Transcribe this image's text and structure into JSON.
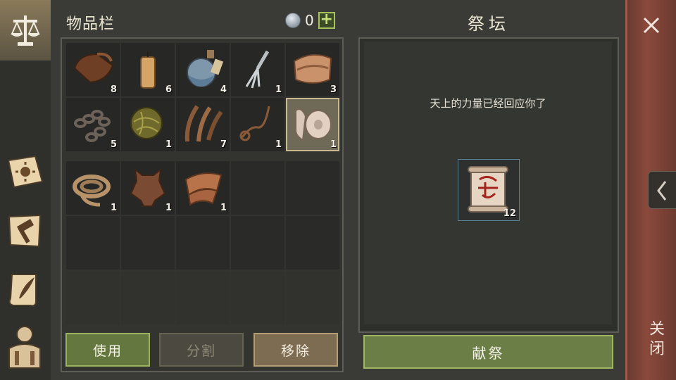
{
  "rail": {
    "icons": [
      "scales-icon",
      "sun-book-icon",
      "hammer-map-icon",
      "quill-scroll-icon",
      "character-icon"
    ]
  },
  "inventory": {
    "title": "物品栏",
    "currency_value": "0",
    "add_label": "+",
    "top_slots": [
      {
        "icon": "leather-scroll-icon",
        "qty": "8"
      },
      {
        "icon": "candle-icon",
        "qty": "6"
      },
      {
        "icon": "potion-flask-icon",
        "qty": "4"
      },
      {
        "icon": "fork-trap-icon",
        "qty": "1"
      },
      {
        "icon": "cloth-bundle-icon",
        "qty": "3"
      },
      {
        "icon": "chain-icon",
        "qty": "5"
      },
      {
        "icon": "vine-ball-icon",
        "qty": "1"
      },
      {
        "icon": "fiber-strands-icon",
        "qty": "7"
      },
      {
        "icon": "whip-icon",
        "qty": "1"
      },
      {
        "icon": "cloth-roll-icon",
        "qty": "1"
      }
    ],
    "bottom_slots": [
      {
        "icon": "rope-coil-icon",
        "qty": "1"
      },
      {
        "icon": "animal-hide-icon",
        "qty": "1"
      },
      {
        "icon": "fabric-piece-icon",
        "qty": "1"
      }
    ],
    "buttons": {
      "use": "使用",
      "split": "分割",
      "remove": "移除"
    }
  },
  "altar": {
    "title": "祭坛",
    "message": "天上的力量已经回应你了",
    "slot": {
      "icon": "rune-scroll-icon",
      "qty": "12"
    },
    "offer": "献祭"
  },
  "close": {
    "label": "关闭"
  },
  "colors": {
    "accent_green": "#6a7e45",
    "close_red": "#8a4a3c",
    "selected": "#c8b98f"
  }
}
